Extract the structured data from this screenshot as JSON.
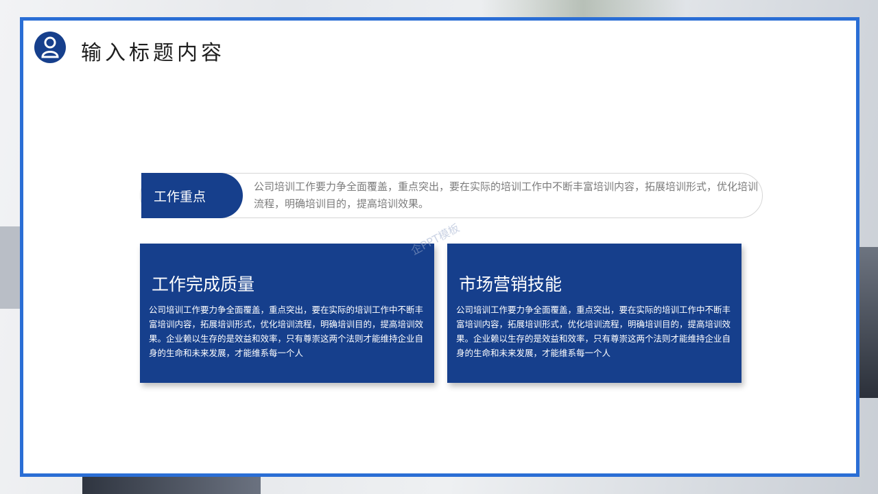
{
  "slide": {
    "badge_icon": "person-icon",
    "title": "输入标题内容",
    "accent_color": "#163f8c",
    "frame_color": "#2a6ed5"
  },
  "focus": {
    "tag": "工作重点",
    "text": "公司培训工作要力争全面覆盖，重点突出，要在实际的培训工作中不断丰富培训内容，拓展培训形式，优化培训流程，明确培训目的，提高培训效果。"
  },
  "cards": [
    {
      "title": "工作完成质量",
      "body": "公司培训工作要力争全面覆盖，重点突出，要在实际的培训工作中不断丰富培训内容，拓展培训形式，优化培训流程，明确培训目的，提高培训效果。企业赖以生存的是效益和效率，只有尊崇这两个法则才能维持企业自身的生命和未来发展，才能维系每一个人"
    },
    {
      "title": "市场营销技能",
      "body": "公司培训工作要力争全面覆盖，重点突出，要在实际的培训工作中不断丰富培训内容，拓展培训形式，优化培训流程，明确培训目的，提高培训效果。企业赖以生存的是效益和效率，只有尊崇这两个法则才能维持企业自身的生命和未来发展，才能维系每一个人"
    }
  ],
  "watermark": "企PPT模板"
}
